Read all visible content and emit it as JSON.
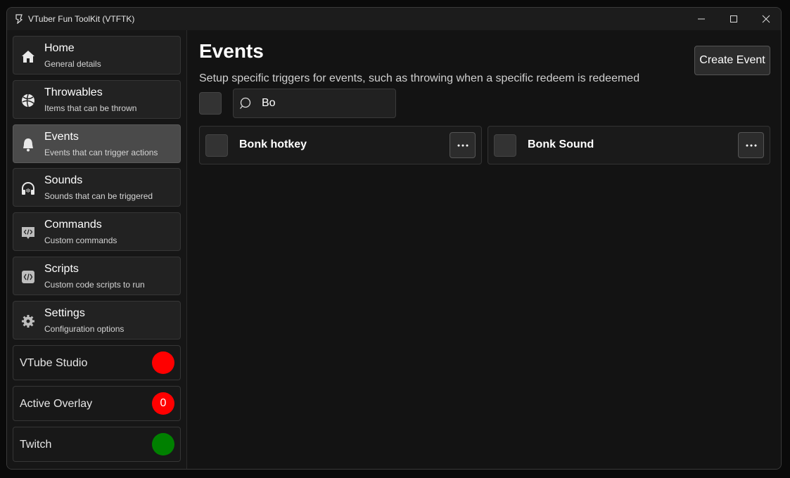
{
  "window": {
    "title": "VTuber Fun ToolKit (VTFTK)"
  },
  "sidebar": {
    "items": [
      {
        "title": "Home",
        "subtitle": "General details",
        "icon": "home-icon",
        "active": false
      },
      {
        "title": "Throwables",
        "subtitle": "Items that can be thrown",
        "icon": "ball-icon",
        "active": false
      },
      {
        "title": "Events",
        "subtitle": "Events that can trigger actions",
        "icon": "bell-icon",
        "active": true
      },
      {
        "title": "Sounds",
        "subtitle": "Sounds that can be triggered",
        "icon": "headphones-icon",
        "active": false
      },
      {
        "title": "Commands",
        "subtitle": "Custom commands",
        "icon": "command-icon",
        "active": false
      },
      {
        "title": "Scripts",
        "subtitle": "Custom code scripts to run",
        "icon": "code-icon",
        "active": false
      },
      {
        "title": "Settings",
        "subtitle": "Configuration options",
        "icon": "gear-icon",
        "active": false
      }
    ],
    "status": [
      {
        "label": "VTube Studio",
        "value": "",
        "color": "#ff0000"
      },
      {
        "label": "Active Overlay",
        "value": "0",
        "color": "#ff0000"
      },
      {
        "label": "Twitch",
        "value": "",
        "color": "#008000"
      }
    ]
  },
  "main": {
    "title": "Events",
    "subtitle": "Setup specific triggers for events, such as throwing when a specific redeem is redeemed",
    "create_label": "Create Event",
    "search": {
      "value": "Bo"
    },
    "events": [
      {
        "name": "Bonk hotkey"
      },
      {
        "name": "Bonk Sound"
      }
    ]
  }
}
